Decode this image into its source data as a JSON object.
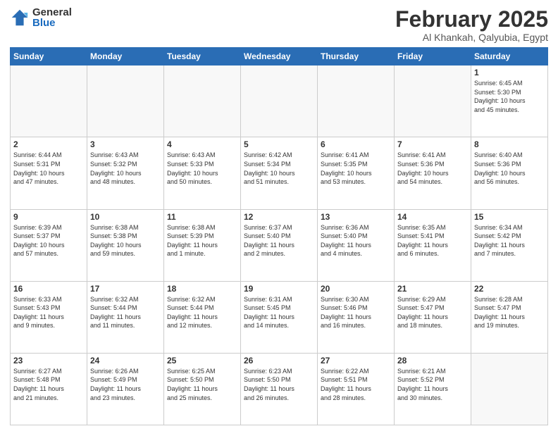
{
  "logo": {
    "general": "General",
    "blue": "Blue"
  },
  "title": "February 2025",
  "subtitle": "Al Khankah, Qalyubia, Egypt",
  "days_of_week": [
    "Sunday",
    "Monday",
    "Tuesday",
    "Wednesday",
    "Thursday",
    "Friday",
    "Saturday"
  ],
  "weeks": [
    [
      {
        "num": "",
        "info": ""
      },
      {
        "num": "",
        "info": ""
      },
      {
        "num": "",
        "info": ""
      },
      {
        "num": "",
        "info": ""
      },
      {
        "num": "",
        "info": ""
      },
      {
        "num": "",
        "info": ""
      },
      {
        "num": "1",
        "info": "Sunrise: 6:45 AM\nSunset: 5:30 PM\nDaylight: 10 hours\nand 45 minutes."
      }
    ],
    [
      {
        "num": "2",
        "info": "Sunrise: 6:44 AM\nSunset: 5:31 PM\nDaylight: 10 hours\nand 47 minutes."
      },
      {
        "num": "3",
        "info": "Sunrise: 6:43 AM\nSunset: 5:32 PM\nDaylight: 10 hours\nand 48 minutes."
      },
      {
        "num": "4",
        "info": "Sunrise: 6:43 AM\nSunset: 5:33 PM\nDaylight: 10 hours\nand 50 minutes."
      },
      {
        "num": "5",
        "info": "Sunrise: 6:42 AM\nSunset: 5:34 PM\nDaylight: 10 hours\nand 51 minutes."
      },
      {
        "num": "6",
        "info": "Sunrise: 6:41 AM\nSunset: 5:35 PM\nDaylight: 10 hours\nand 53 minutes."
      },
      {
        "num": "7",
        "info": "Sunrise: 6:41 AM\nSunset: 5:36 PM\nDaylight: 10 hours\nand 54 minutes."
      },
      {
        "num": "8",
        "info": "Sunrise: 6:40 AM\nSunset: 5:36 PM\nDaylight: 10 hours\nand 56 minutes."
      }
    ],
    [
      {
        "num": "9",
        "info": "Sunrise: 6:39 AM\nSunset: 5:37 PM\nDaylight: 10 hours\nand 57 minutes."
      },
      {
        "num": "10",
        "info": "Sunrise: 6:38 AM\nSunset: 5:38 PM\nDaylight: 10 hours\nand 59 minutes."
      },
      {
        "num": "11",
        "info": "Sunrise: 6:38 AM\nSunset: 5:39 PM\nDaylight: 11 hours\nand 1 minute."
      },
      {
        "num": "12",
        "info": "Sunrise: 6:37 AM\nSunset: 5:40 PM\nDaylight: 11 hours\nand 2 minutes."
      },
      {
        "num": "13",
        "info": "Sunrise: 6:36 AM\nSunset: 5:40 PM\nDaylight: 11 hours\nand 4 minutes."
      },
      {
        "num": "14",
        "info": "Sunrise: 6:35 AM\nSunset: 5:41 PM\nDaylight: 11 hours\nand 6 minutes."
      },
      {
        "num": "15",
        "info": "Sunrise: 6:34 AM\nSunset: 5:42 PM\nDaylight: 11 hours\nand 7 minutes."
      }
    ],
    [
      {
        "num": "16",
        "info": "Sunrise: 6:33 AM\nSunset: 5:43 PM\nDaylight: 11 hours\nand 9 minutes."
      },
      {
        "num": "17",
        "info": "Sunrise: 6:32 AM\nSunset: 5:44 PM\nDaylight: 11 hours\nand 11 minutes."
      },
      {
        "num": "18",
        "info": "Sunrise: 6:32 AM\nSunset: 5:44 PM\nDaylight: 11 hours\nand 12 minutes."
      },
      {
        "num": "19",
        "info": "Sunrise: 6:31 AM\nSunset: 5:45 PM\nDaylight: 11 hours\nand 14 minutes."
      },
      {
        "num": "20",
        "info": "Sunrise: 6:30 AM\nSunset: 5:46 PM\nDaylight: 11 hours\nand 16 minutes."
      },
      {
        "num": "21",
        "info": "Sunrise: 6:29 AM\nSunset: 5:47 PM\nDaylight: 11 hours\nand 18 minutes."
      },
      {
        "num": "22",
        "info": "Sunrise: 6:28 AM\nSunset: 5:47 PM\nDaylight: 11 hours\nand 19 minutes."
      }
    ],
    [
      {
        "num": "23",
        "info": "Sunrise: 6:27 AM\nSunset: 5:48 PM\nDaylight: 11 hours\nand 21 minutes."
      },
      {
        "num": "24",
        "info": "Sunrise: 6:26 AM\nSunset: 5:49 PM\nDaylight: 11 hours\nand 23 minutes."
      },
      {
        "num": "25",
        "info": "Sunrise: 6:25 AM\nSunset: 5:50 PM\nDaylight: 11 hours\nand 25 minutes."
      },
      {
        "num": "26",
        "info": "Sunrise: 6:23 AM\nSunset: 5:50 PM\nDaylight: 11 hours\nand 26 minutes."
      },
      {
        "num": "27",
        "info": "Sunrise: 6:22 AM\nSunset: 5:51 PM\nDaylight: 11 hours\nand 28 minutes."
      },
      {
        "num": "28",
        "info": "Sunrise: 6:21 AM\nSunset: 5:52 PM\nDaylight: 11 hours\nand 30 minutes."
      },
      {
        "num": "",
        "info": ""
      }
    ]
  ]
}
